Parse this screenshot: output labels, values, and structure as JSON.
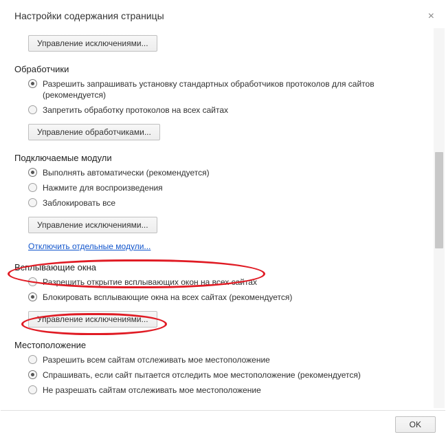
{
  "dialog": {
    "title": "Настройки содержания страницы",
    "close": "×",
    "ok": "OK"
  },
  "top": {
    "manage_exceptions": "Управление исключениями..."
  },
  "handlers": {
    "title": "Обработчики",
    "opt_allow": "Разрешить запрашивать установку стандартных обработчиков протоколов для сайтов (рекомендуется)",
    "opt_deny": "Запретить обработку протоколов на всех сайтах",
    "manage": "Управление обработчиками..."
  },
  "plugins": {
    "title": "Подключаемые модули",
    "opt_auto": "Выполнять автоматически (рекомендуется)",
    "opt_click": "Нажмите для воспроизведения",
    "opt_block": "Заблокировать все",
    "manage": "Управление исключениями...",
    "disable_link": "Отключить отдельные модули..."
  },
  "popups": {
    "title": "Всплывающие окна",
    "opt_allow": "Разрешить открытие всплывающих окон на всех сайтах",
    "opt_block": "Блокировать всплывающие окна на всех сайтах (рекомендуется)",
    "manage": "Управление исключениями..."
  },
  "location": {
    "title": "Местоположение",
    "opt_allow": "Разрешить всем сайтам отслеживать мое местоположение",
    "opt_ask": "Спрашивать, если сайт пытается отследить мое местоположение (рекомендуется)",
    "opt_deny": "Не разрешать сайтам отслеживать мое местоположение"
  }
}
